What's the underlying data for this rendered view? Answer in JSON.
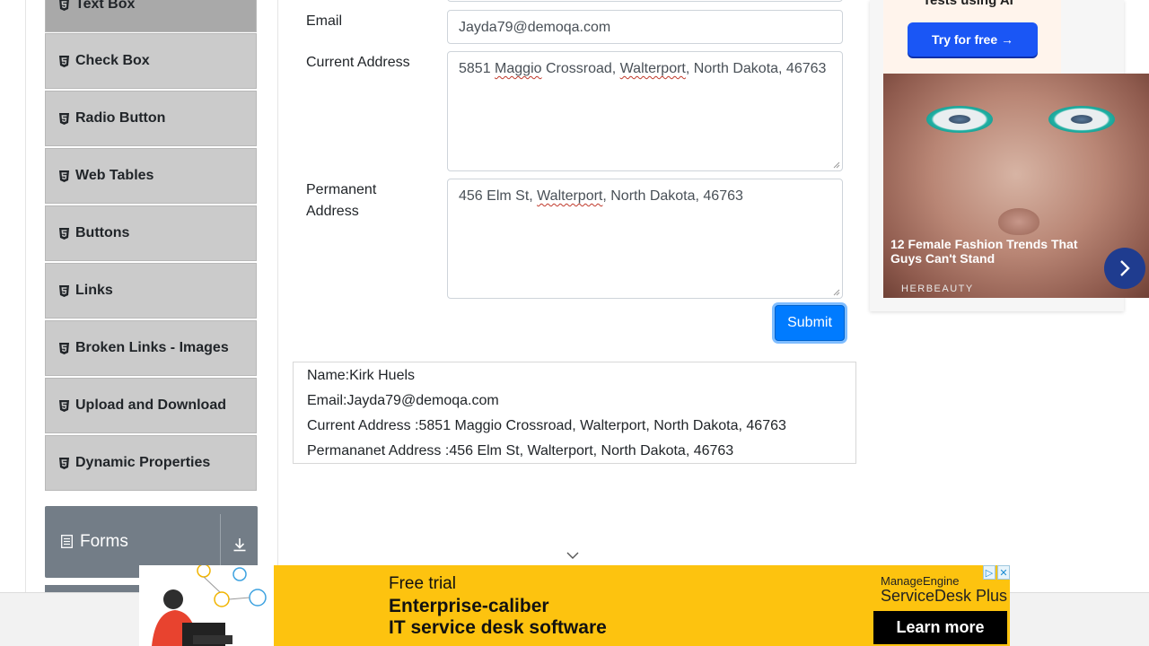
{
  "sidebar": {
    "items": [
      {
        "label": "Text Box"
      },
      {
        "label": "Check Box"
      },
      {
        "label": "Radio Button"
      },
      {
        "label": "Web Tables"
      },
      {
        "label": "Buttons"
      },
      {
        "label": "Links"
      },
      {
        "label": "Broken Links - Images"
      },
      {
        "label": "Upload and Download"
      },
      {
        "label": "Dynamic Properties"
      }
    ],
    "group": {
      "title": "Forms"
    }
  },
  "form": {
    "email_label": "Email",
    "email_value": "Jayda79@demoqa.com",
    "current_address_label": "Current Address",
    "current_address_parts": [
      "5851 ",
      "Maggio",
      " Crossroad, ",
      "Walterport",
      ", North Dakota, 46763"
    ],
    "permanent_address_label_line1": "Permanent",
    "permanent_address_label_line2": "Address",
    "permanent_address_parts": [
      "456 Elm St, ",
      "Walterport",
      ", North Dakota, 46763"
    ],
    "submit_label": "Submit"
  },
  "output": {
    "name": "Name:Kirk Huels",
    "email": "Email:Jayda79@demoqa.com",
    "current_address": "Current Address :5851 Maggio Crossroad, Walterport, North Dakota, 46763",
    "permanent_address": "Permananet Address :456 Elm St, Walterport, North Dakota, 46763"
  },
  "ad_right": {
    "top_text": "Tests using AI",
    "button": "Try for free →",
    "caption": "12 Female Fashion Trends That Guys Can't Stand",
    "brand": "HERBEAUTY"
  },
  "banner": {
    "line1": "Free trial",
    "line2": "Enterprise-caliber",
    "line3": "IT service desk software",
    "logo_line1": "ManageEngine",
    "logo_line2": "ServiceDesk Plus",
    "cta": "Learn more"
  },
  "colors": {
    "primary": "#007bff",
    "sidebar_item": "#cbcbcb",
    "group_header": "#737d87",
    "banner_bg": "#fdc30f"
  }
}
